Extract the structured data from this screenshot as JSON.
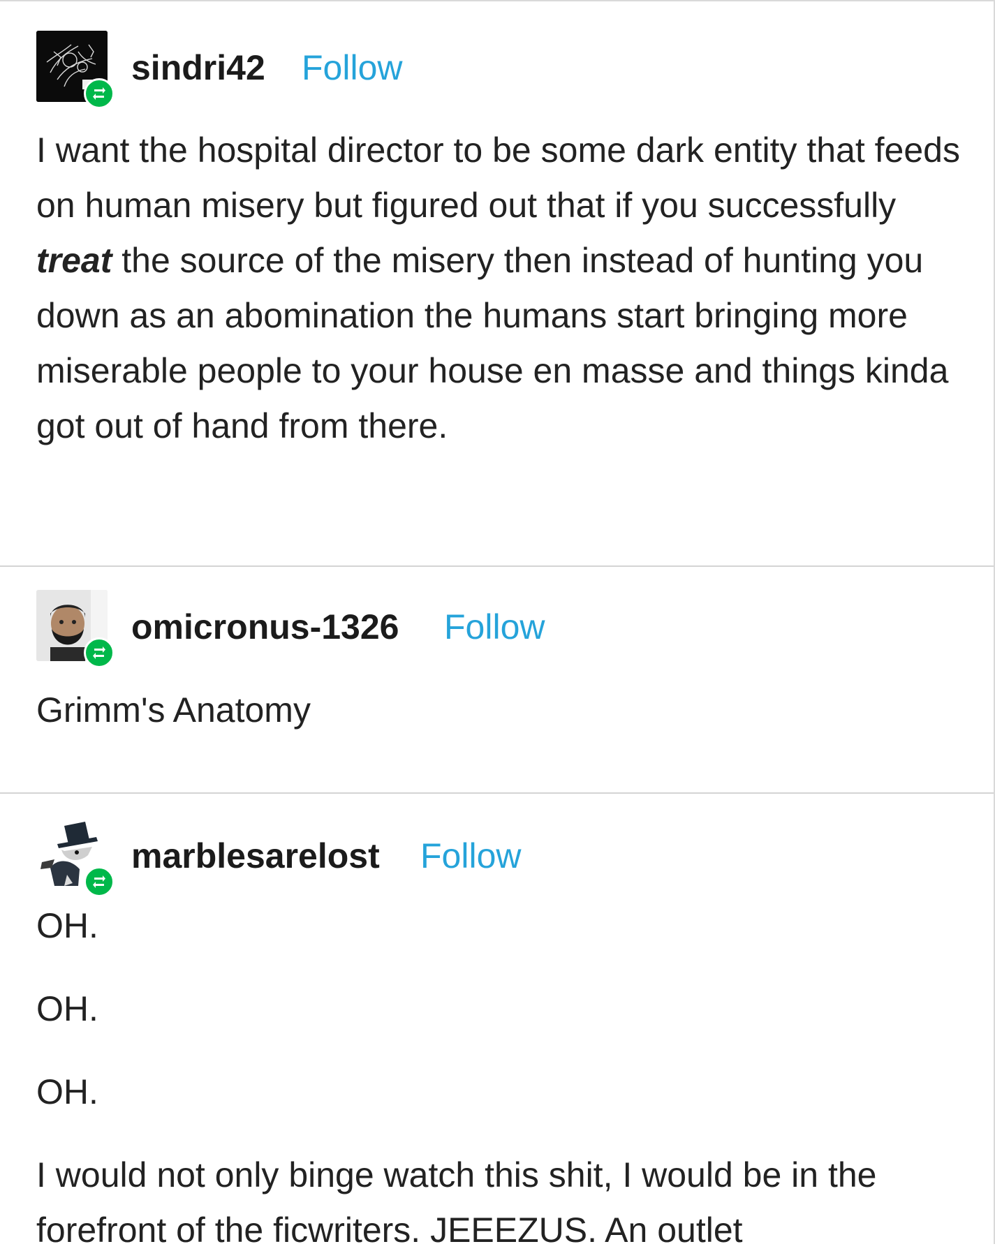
{
  "posts": [
    {
      "username": "sindri42",
      "follow_label": "Follow",
      "avatar_icon": "dark-artwork-avatar",
      "badge_icon": "reblog-icon",
      "text_before": "I want the hospital director to be some dark entity that feeds on human misery but figured out that if you successfully ",
      "text_emphasis": "treat",
      "text_after": " the source of the misery then instead of hunting you down as an abomination the humans start bringing more miserable people to your house en masse and things kinda got out of hand from there."
    },
    {
      "username": "omicronus-1326",
      "follow_label": "Follow",
      "avatar_icon": "bearded-person-avatar",
      "badge_icon": "reblog-icon",
      "text": "Grimm's Anatomy"
    },
    {
      "username": "marblesarelost",
      "follow_label": "Follow",
      "avatar_icon": "cartoon-character-avatar",
      "badge_icon": "reblog-icon",
      "lines": [
        "OH.",
        "OH.",
        "OH."
      ],
      "closing": "I would not only binge watch this shit, I would be in the forefront of the ficwriters. JEEEZUS. An outlet"
    }
  ],
  "colors": {
    "follow": "#25a3da",
    "reblog_badge": "#00b84a",
    "divider": "#d4d4d4"
  }
}
